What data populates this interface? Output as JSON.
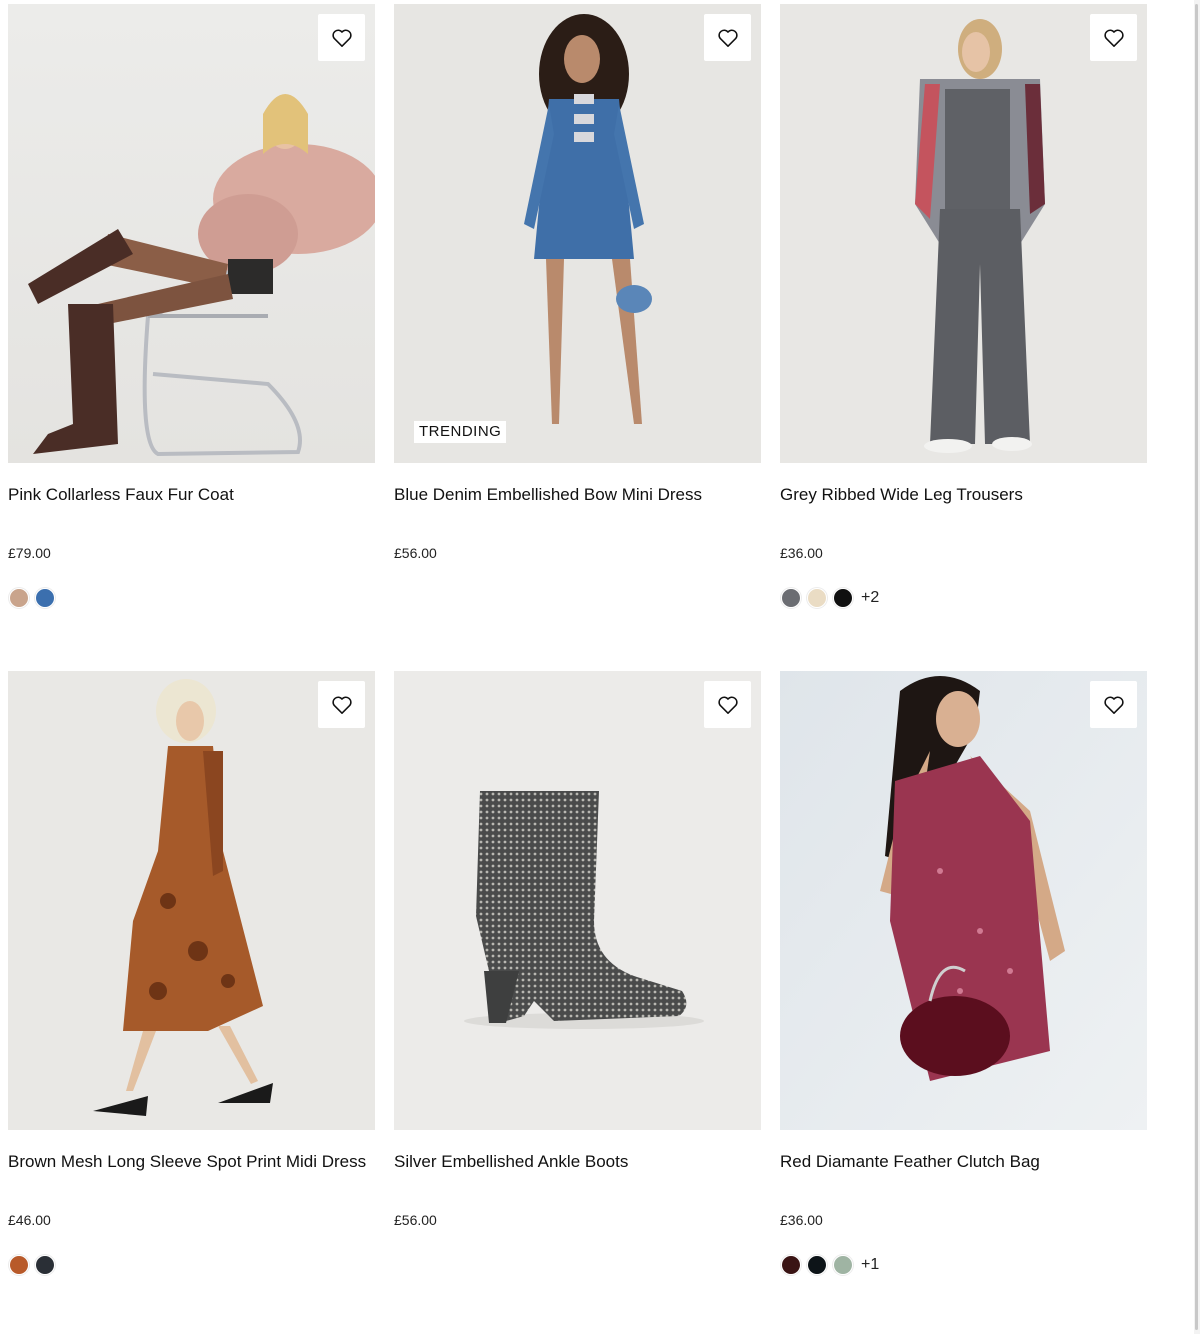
{
  "products": [
    {
      "title": "Pink Collarless Faux Fur Coat",
      "price": "£79.00",
      "badge": "",
      "swatches": [
        "#c9a48c",
        "#3b6fae"
      ],
      "more": ""
    },
    {
      "title": "Blue Denim Embellished Bow Mini Dress",
      "price": "£56.00",
      "badge": "TRENDING",
      "swatches": [],
      "more": ""
    },
    {
      "title": "Grey Ribbed Wide Leg Trousers",
      "price": "£36.00",
      "badge": "",
      "swatches": [
        "#6b6d72",
        "#eadcc4",
        "#101010"
      ],
      "more": "+2"
    },
    {
      "title": "Brown Mesh Long Sleeve Spot Print Midi Dress",
      "price": "£46.00",
      "badge": "",
      "swatches": [
        "#b85a2a",
        "#2a2f36"
      ],
      "more": ""
    },
    {
      "title": "Silver Embellished Ankle Boots",
      "price": "£56.00",
      "badge": "",
      "swatches": [],
      "more": ""
    },
    {
      "title": "Red Diamante Feather Clutch Bag",
      "price": "£36.00",
      "badge": "",
      "swatches": [
        "#3a1414",
        "#0d1418",
        "#9fb4a3"
      ],
      "more": "+1"
    }
  ],
  "icons": {
    "wishlist": "heart-outline-icon"
  }
}
